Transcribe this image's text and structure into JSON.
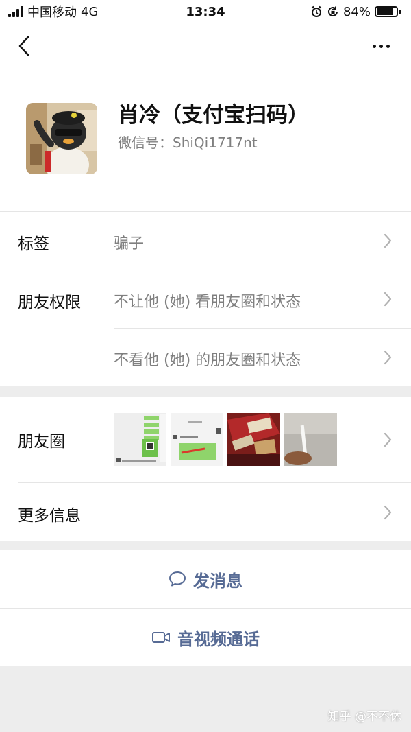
{
  "status_bar": {
    "carrier": "中国移动",
    "network": "4G",
    "time": "13:34",
    "battery_percent": "84%",
    "battery_level": 0.84
  },
  "nav": {
    "back_icon": "chevron-left-icon",
    "more_icon": "more-dots-icon"
  },
  "profile": {
    "name": "肖冷（支付宝扫码）",
    "wechat_id_label": "微信号：",
    "wechat_id": "ShiQi1717nt"
  },
  "rows": {
    "tags": {
      "label": "标签",
      "value": "骗子"
    },
    "permissions": {
      "label": "朋友权限",
      "value_1": "不让他 (她) 看朋友圈和状态",
      "value_2": "不看他 (她) 的朋友圈和状态"
    },
    "moments": {
      "label": "朋友圈"
    },
    "more_info": {
      "label": "更多信息"
    }
  },
  "actions": {
    "message": {
      "label": "发消息",
      "icon": "chat-bubble-icon"
    },
    "call": {
      "label": "音视频通话",
      "icon": "video-camera-icon"
    }
  },
  "watermark": "知乎 @不不休",
  "colors": {
    "link_blue": "#576b95",
    "secondary_gray": "#7f7f7f",
    "background": "#ededed"
  }
}
